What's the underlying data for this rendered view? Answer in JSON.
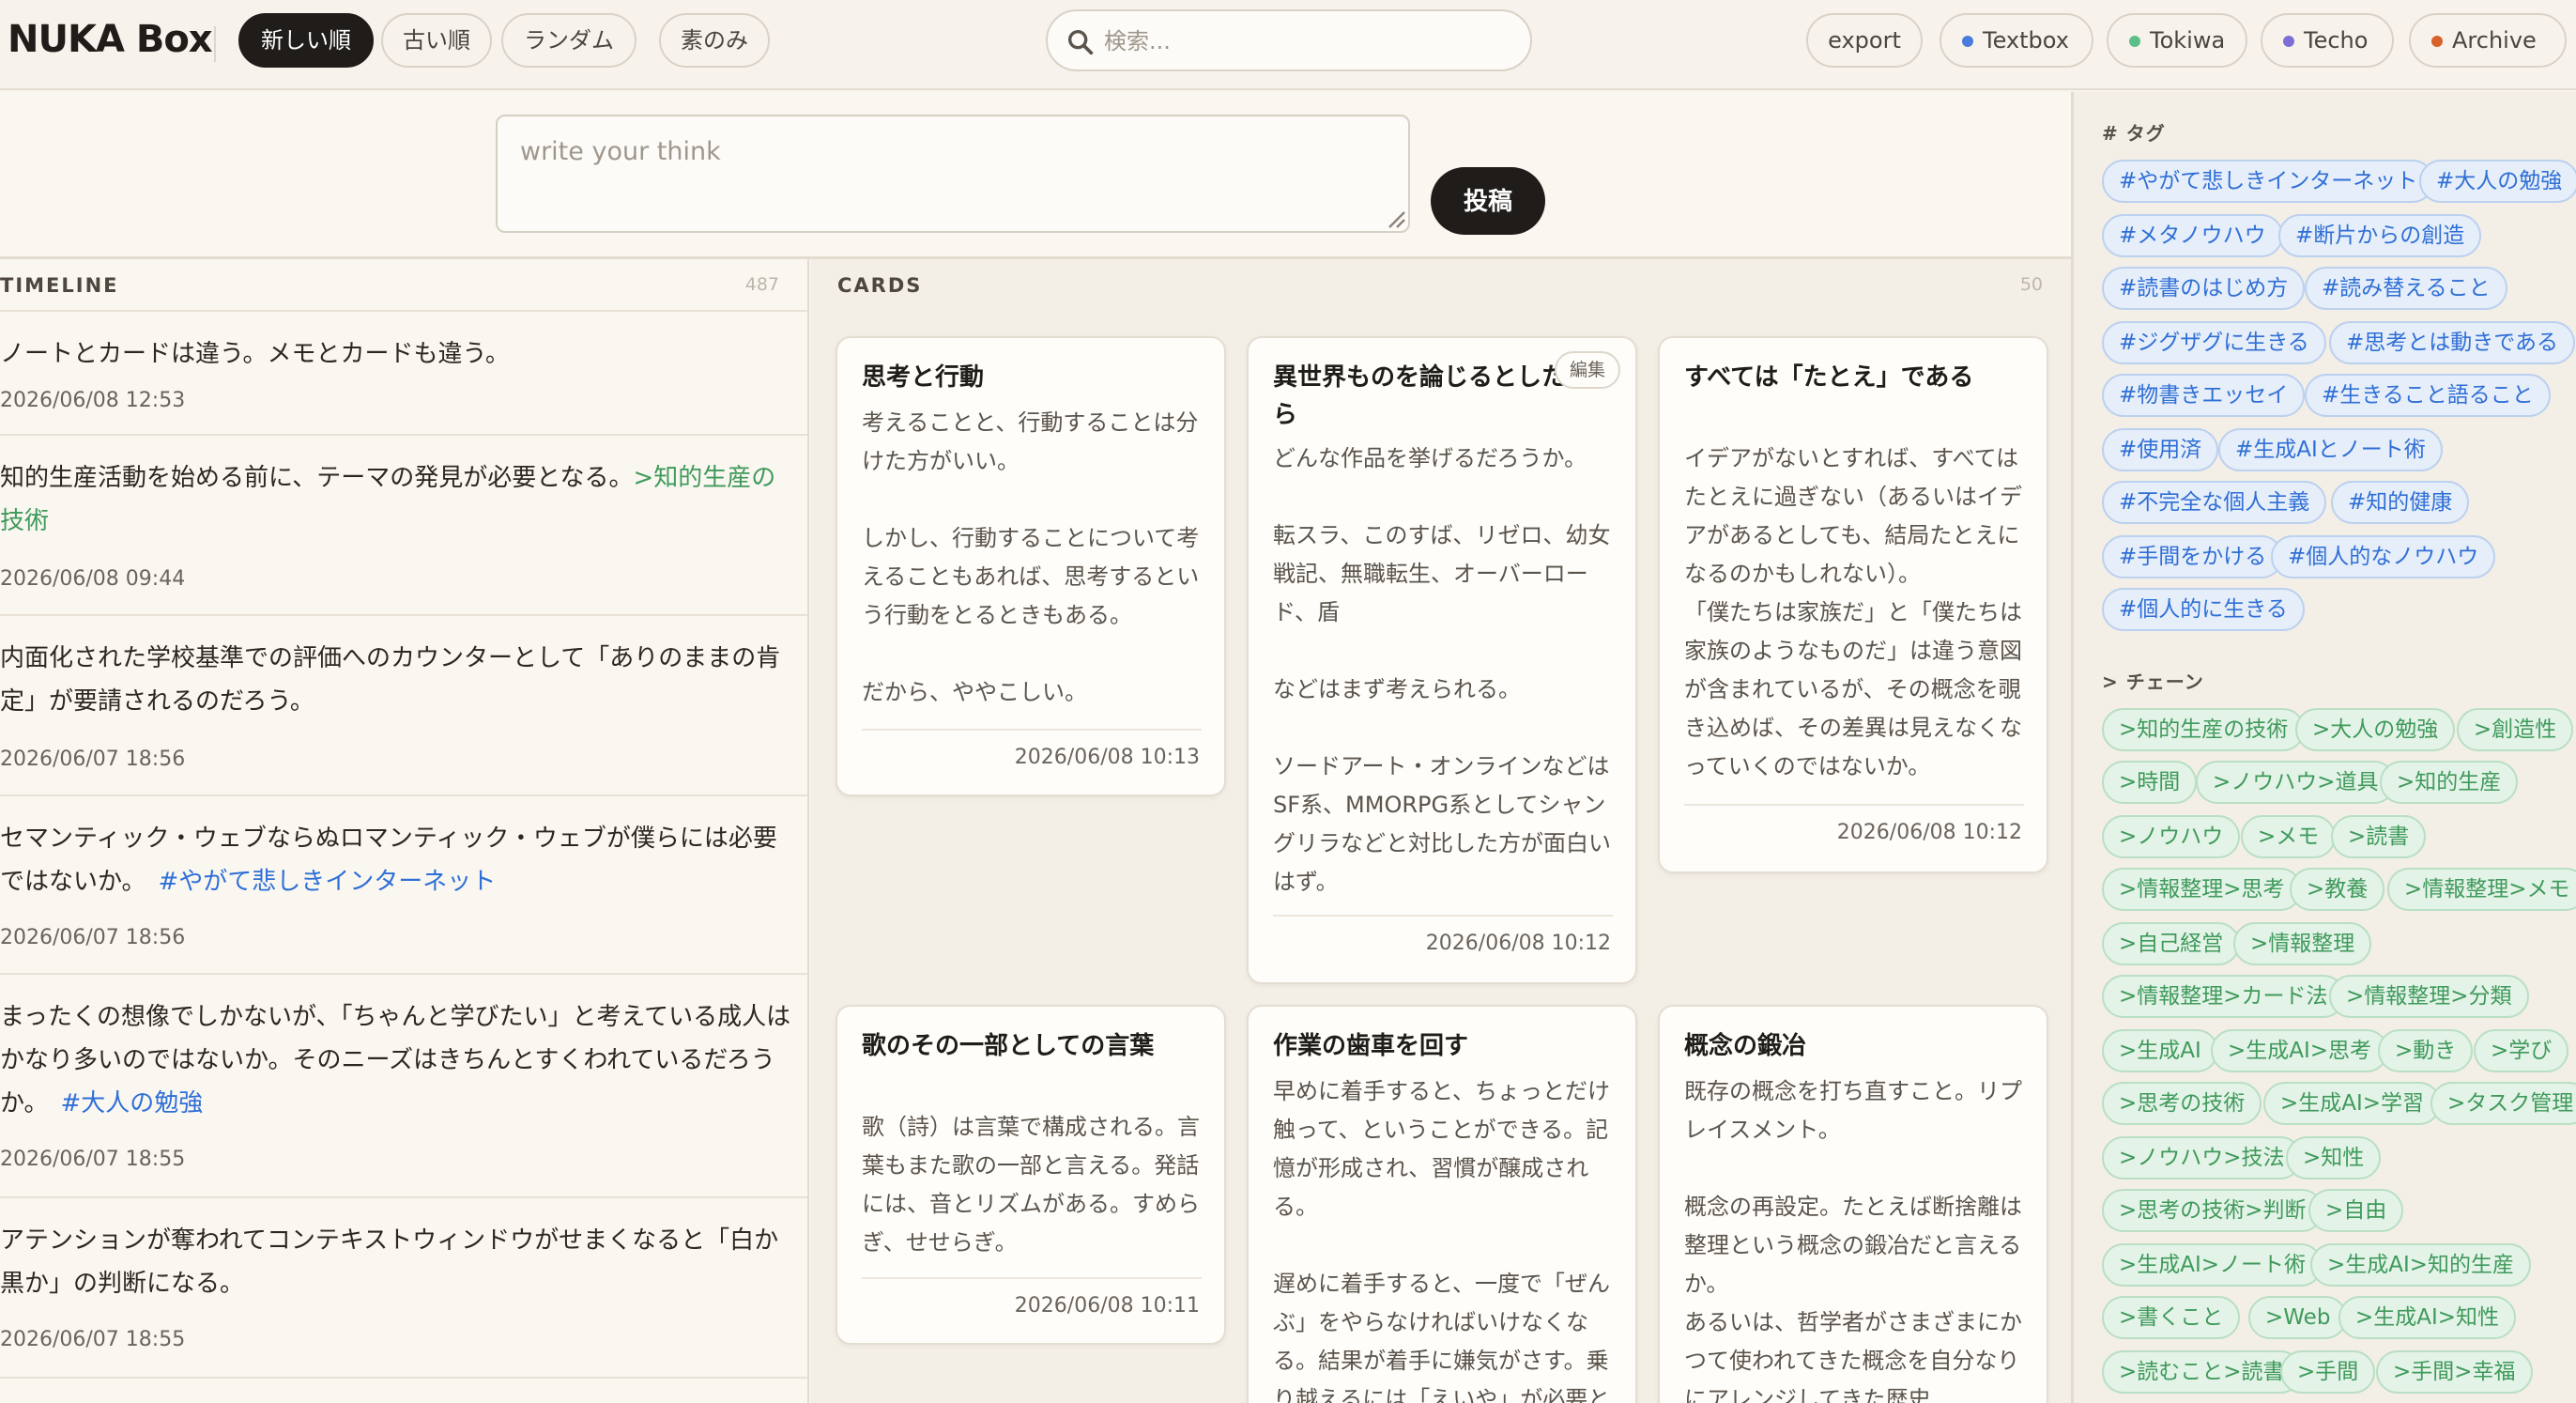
{
  "header": {
    "brand": "NUKA Box",
    "sort_tabs": [
      "新しい順",
      "古い順",
      "ランダム",
      "素のみ"
    ],
    "search_placeholder": "検索...",
    "export_label": "export",
    "spaces": [
      {
        "label": "Textbox",
        "color": "#4a7bdc"
      },
      {
        "label": "Tokiwa",
        "color": "#5cbf8a"
      },
      {
        "label": "Techo",
        "color": "#7b6fd6"
      },
      {
        "label": "Archive",
        "color": "#d9622b"
      }
    ]
  },
  "compose": {
    "placeholder": "write your think",
    "post_label": "投稿"
  },
  "timeline": {
    "title": "TIMELINE",
    "count": "487",
    "items": [
      {
        "text": "ノートとカードは違う。メモとカードも違う。",
        "link": "",
        "link_type": "",
        "date": "2026/06/08 12:53"
      },
      {
        "text": "知的生産活動を始める前に、テーマの発見が必要となる。",
        "link": ">知的生産の技術",
        "link_type": "chain",
        "date": "2026/06/08 09:44"
      },
      {
        "text": "内面化された学校基準での評価へのカウンターとして「ありのままの肯定」が要請されるのだろう。",
        "link": "",
        "link_type": "",
        "date": "2026/06/07 18:56"
      },
      {
        "text": "セマンティック・ウェブならぬロマンティック・ウェブが僕らには必要ではないか。",
        "link": "#やがて悲しきインターネット",
        "link_type": "tag",
        "date": "2026/06/07 18:56"
      },
      {
        "text": "まったくの想像でしかないが、「ちゃんと学びたい」と考えている成人はかなり多いのではないか。そのニーズはきちんとすくわれているだろうか。",
        "link": "#大人の勉強",
        "link_type": "tag",
        "date": "2026/06/07 18:55"
      },
      {
        "text": "アテンションが奪われてコンテキストウィンドウがせまくなると「白か黒か」の判断になる。",
        "link": "",
        "link_type": "",
        "date": "2026/06/07 18:55"
      }
    ]
  },
  "cards": {
    "title": "CARDS",
    "count": "50",
    "edit_label": "編集",
    "items": [
      {
        "title": "思考と行動",
        "body": "考えることと、行動することは分けた方がいい。\n\nしかし、行動することについて考えることもあれば、思考するという行動をとるときもある。\n\nだから、ややこしい。",
        "date": "2026/06/08 10:13"
      },
      {
        "title": "異世界ものを論じるとしたら",
        "body": "どんな作品を挙げるだろうか。\n\n転スラ、このすば、リゼロ、幼女戦記、無職転生、オーバーロード、盾\n\nなどはまず考えられる。\n\nソードアート・オンラインなどはSF系、MMORPG系としてシャングリラなどと対比した方が面白いはず。",
        "date": "2026/06/08 10:12"
      },
      {
        "title": "すべては「たとえ」である",
        "body": "イデアがないとすれば、すべてはたとえに過ぎない（あるいはイデアがあるとしても、結局たとえになるのかもしれない）。\n「僕たちは家族だ」と「僕たちは家族のようなものだ」は違う意図が含まれているが、その概念を覗き込めば、その差異は見えなくなっていくのではないか。",
        "date": "2026/06/08 10:12"
      },
      {
        "title": "歌のその一部としての言葉",
        "body": "歌（詩）は言葉で構成される。言葉もまた歌の一部と言える。発話には、音とリズムがある。すめらぎ、せせらぎ。",
        "date": "2026/06/08 10:11"
      },
      {
        "title": "作業の歯車を回す",
        "body": "早めに着手すると、ちょっとだけ触って、ということができる。記憶が形成され、習慣が醸成される。\n\n遅めに着手すると、一度で「ぜんぶ」をやらなければいけなくなる。結果が着手に嫌気がさす。乗り越えるには「えいや」が必要と",
        "date": ""
      },
      {
        "title": "概念の鍛冶",
        "body": "既存の概念を打ち直すこと。リプレイスメント。\n\n概念の再設定。たとえば断捨離は整理という概念の鍛冶だと言えるか。\nあるいは、哲学者がさまざまにかつて使われてきた概念を自分なりにアレンジしてきた歴史",
        "date": ""
      }
    ]
  },
  "sidebar": {
    "tags_heading": "# タグ",
    "tags": [
      "#やがて悲しきインターネット",
      "#大人の勉強",
      "#メタノウハウ",
      "#断片からの創造",
      "#読書のはじめ方",
      "#読み替えること",
      "#ジグザグに生きる",
      "#思考とは動きである",
      "#物書きエッセイ",
      "#生きること語ること",
      "#使用済",
      "#生成AIとノート術",
      "#不完全な個人主義",
      "#知的健康",
      "#手間をかける",
      "#個人的なノウハウ",
      "#個人的に生きる"
    ],
    "chains_heading": "> チェーン",
    "chains": [
      ">知的生産の技術",
      ">大人の勉強",
      ">創造性",
      ">時間",
      ">ノウハウ>道具",
      ">知的生産",
      ">ノウハウ",
      ">メモ",
      ">読書",
      ">情報整理>思考",
      ">教養",
      ">情報整理>メモ",
      ">自己経営",
      ">情報整理",
      ">情報整理>カード法",
      ">情報整理>分類",
      ">生成AI",
      ">生成AI>思考",
      ">動き",
      ">学び",
      ">思考の技術",
      ">生成AI>学習",
      ">タスク管理",
      ">ノウハウ>技法",
      ">知性",
      ">思考の技術>判断",
      ">自由",
      ">生成AI>ノート術",
      ">生成AI>知的生産",
      ">書くこと",
      ">Web",
      ">生成AI>知性",
      ">読むこと>読書",
      ">手間",
      ">手間>幸福"
    ]
  }
}
